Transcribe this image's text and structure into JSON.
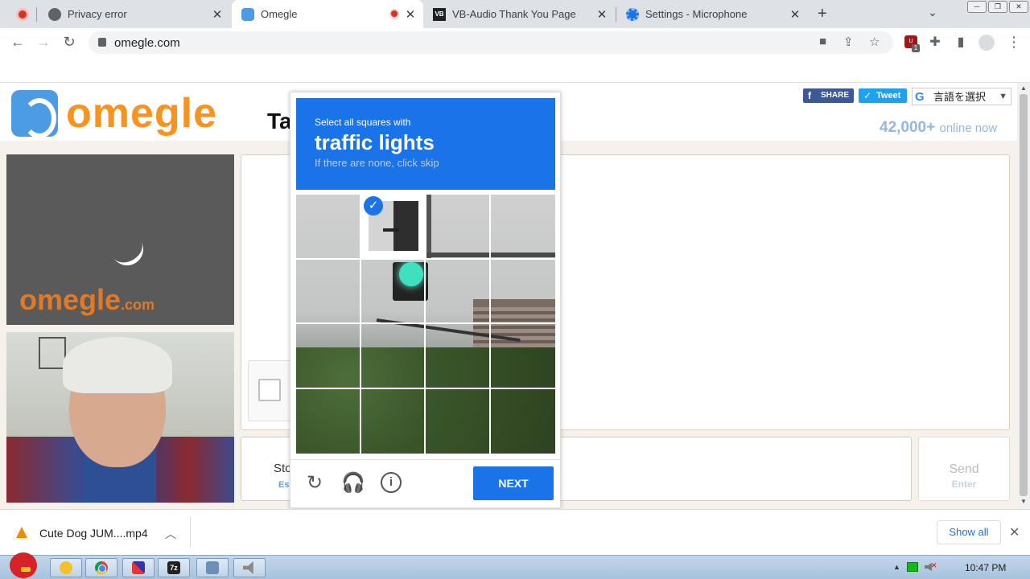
{
  "browser": {
    "tabs": [
      {
        "label": "",
        "favicon": "recording-icon",
        "active": false
      },
      {
        "label": "Privacy error",
        "favicon": "globe-icon",
        "active": false
      },
      {
        "label": "Omegle",
        "favicon": "omegle-icon",
        "active": true
      },
      {
        "label": "VB-Audio Thank You Page",
        "favicon": "vb-audio-icon",
        "active": false
      },
      {
        "label": "Settings - Microphone",
        "favicon": "settings-gear-icon",
        "active": false
      }
    ],
    "url": "omegle.com"
  },
  "omegle": {
    "logo_text": "omegle",
    "tagline": "Ta",
    "share_label": "SHARE",
    "tweet_label": "Tweet",
    "translate_label": "言語を選択",
    "online_count": "42,000+",
    "online_suffix": "online now",
    "video_logo": "omegle",
    "video_logo_suffix": ".com",
    "stop_label": "Sto",
    "stop_hint": "Es",
    "send_label": "Send",
    "send_hint": "Enter"
  },
  "captcha": {
    "instruction": "Select all squares with",
    "target": "traffic lights",
    "hint": "If there are none, click skip",
    "next_label": "NEXT",
    "grid_size": 4,
    "selected_cells": [
      1
    ]
  },
  "download": {
    "filename": "Cute Dog JUM....mp4",
    "show_all": "Show all"
  },
  "taskbar": {
    "clock": "10:47 PM"
  }
}
